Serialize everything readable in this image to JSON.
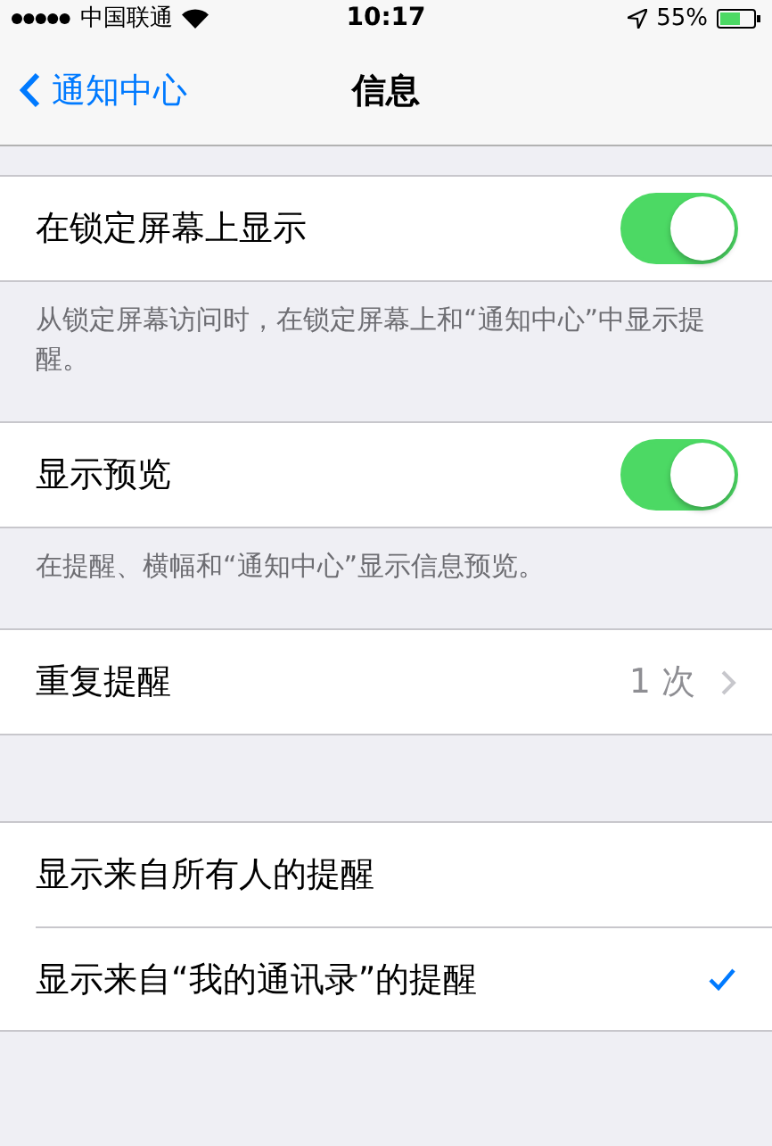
{
  "status_bar": {
    "carrier": "中国联通",
    "time": "10:17",
    "battery": "55%"
  },
  "nav_bar": {
    "back": "通知中心",
    "title": "信息"
  },
  "sections": [
    {
      "rows": [
        {
          "kind": "switch",
          "label": "在锁定屏幕上显示",
          "on": true
        }
      ],
      "footer": "从锁定屏幕访问时，在锁定屏幕上和“通知中心”中显示提醒。"
    },
    {
      "rows": [
        {
          "kind": "switch",
          "label": "显示预览",
          "on": true
        }
      ],
      "footer": "在提醒、横幅和“通知中心”显示信息预览。"
    },
    {
      "rows": [
        {
          "kind": "disclosure",
          "label": "重复提醒",
          "value": "1 次"
        }
      ]
    },
    {
      "rows": [
        {
          "kind": "option",
          "label": "显示来自所有人的提醒",
          "selected": false
        },
        {
          "kind": "option",
          "label": "显示来自“我的通讯录”的提醒",
          "selected": true
        }
      ]
    }
  ]
}
